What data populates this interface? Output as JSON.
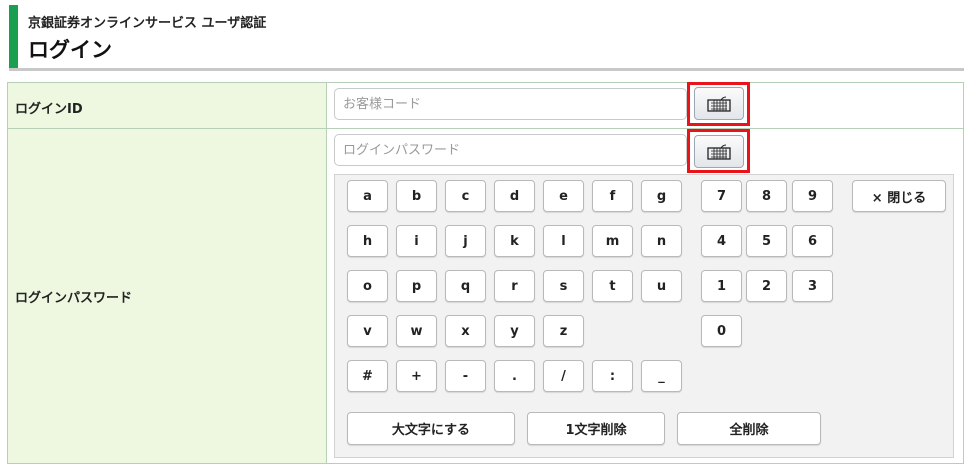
{
  "header": {
    "service_name": "京銀証券オンラインサービス ユーザ認証",
    "title": "ログイン"
  },
  "form": {
    "login_id": {
      "label": "ログインID",
      "placeholder": "お客様コード",
      "value": ""
    },
    "password": {
      "label": "ログインパスワード",
      "placeholder": "ログインパスワード",
      "value": ""
    },
    "keyboard_toggle_icon": "keyboard-icon"
  },
  "software_keyboard": {
    "letter_rows": [
      [
        "a",
        "b",
        "c",
        "d",
        "e",
        "f",
        "g"
      ],
      [
        "h",
        "i",
        "j",
        "k",
        "l",
        "m",
        "n"
      ],
      [
        "o",
        "p",
        "q",
        "r",
        "s",
        "t",
        "u"
      ],
      [
        "v",
        "w",
        "x",
        "y",
        "z"
      ],
      [
        "#",
        "+",
        "-",
        ".",
        "/",
        ":",
        "_"
      ]
    ],
    "number_rows": [
      [
        "7",
        "8",
        "9"
      ],
      [
        "4",
        "5",
        "6"
      ],
      [
        "1",
        "2",
        "3"
      ],
      [
        "0"
      ]
    ],
    "close_label": "× 閉じる",
    "uppercase_label": "大文字にする",
    "delete_one_label": "1文字削除",
    "delete_all_label": "全削除"
  },
  "colors": {
    "accent_green": "#1a9e50",
    "label_background": "#eef8e0",
    "highlight_red": "#e8141a"
  }
}
